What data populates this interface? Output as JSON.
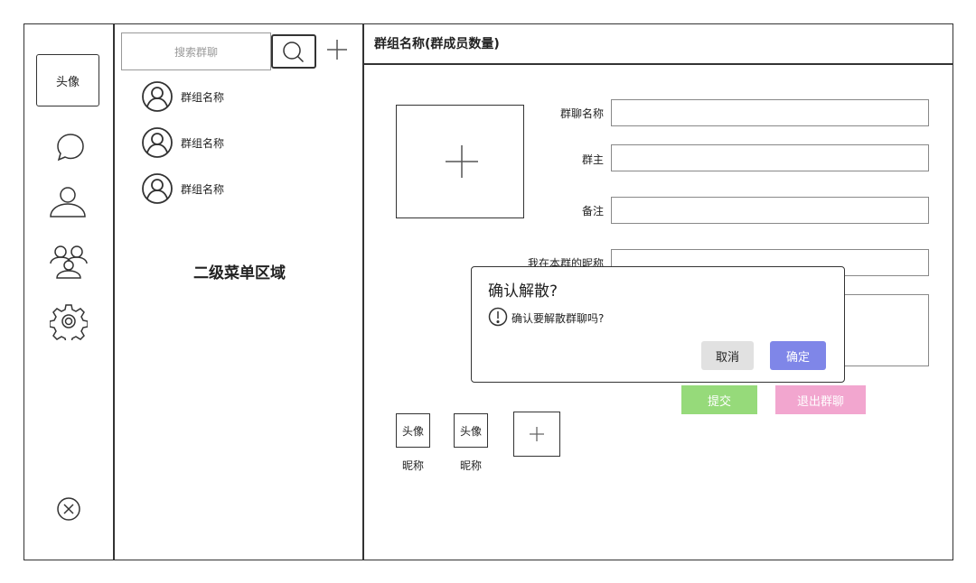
{
  "nav": {
    "avatar_label": "头像",
    "icons": [
      "chat-icon",
      "contact-icon",
      "group-icon",
      "settings-icon",
      "close-icon"
    ]
  },
  "list": {
    "search_placeholder": "搜索群聊",
    "items": [
      {
        "name": "群组名称"
      },
      {
        "name": "群组名称"
      },
      {
        "name": "群组名称"
      }
    ],
    "area_label": "二级菜单区域"
  },
  "main": {
    "title": "群组名称(群成员数量)",
    "form": {
      "name_label": "群聊名称",
      "owner_label": "群主",
      "remark_label": "备注",
      "nickname_label": "我在本群的昵称"
    },
    "submit_label": "提交",
    "quit_label": "退出群聊",
    "members": [
      {
        "avatar": "头像",
        "nickname": "昵称"
      },
      {
        "avatar": "头像",
        "nickname": "昵称"
      }
    ]
  },
  "dialog": {
    "title": "确认解散?",
    "message": "确认要解散群聊吗?",
    "cancel_label": "取消",
    "ok_label": "确定"
  }
}
